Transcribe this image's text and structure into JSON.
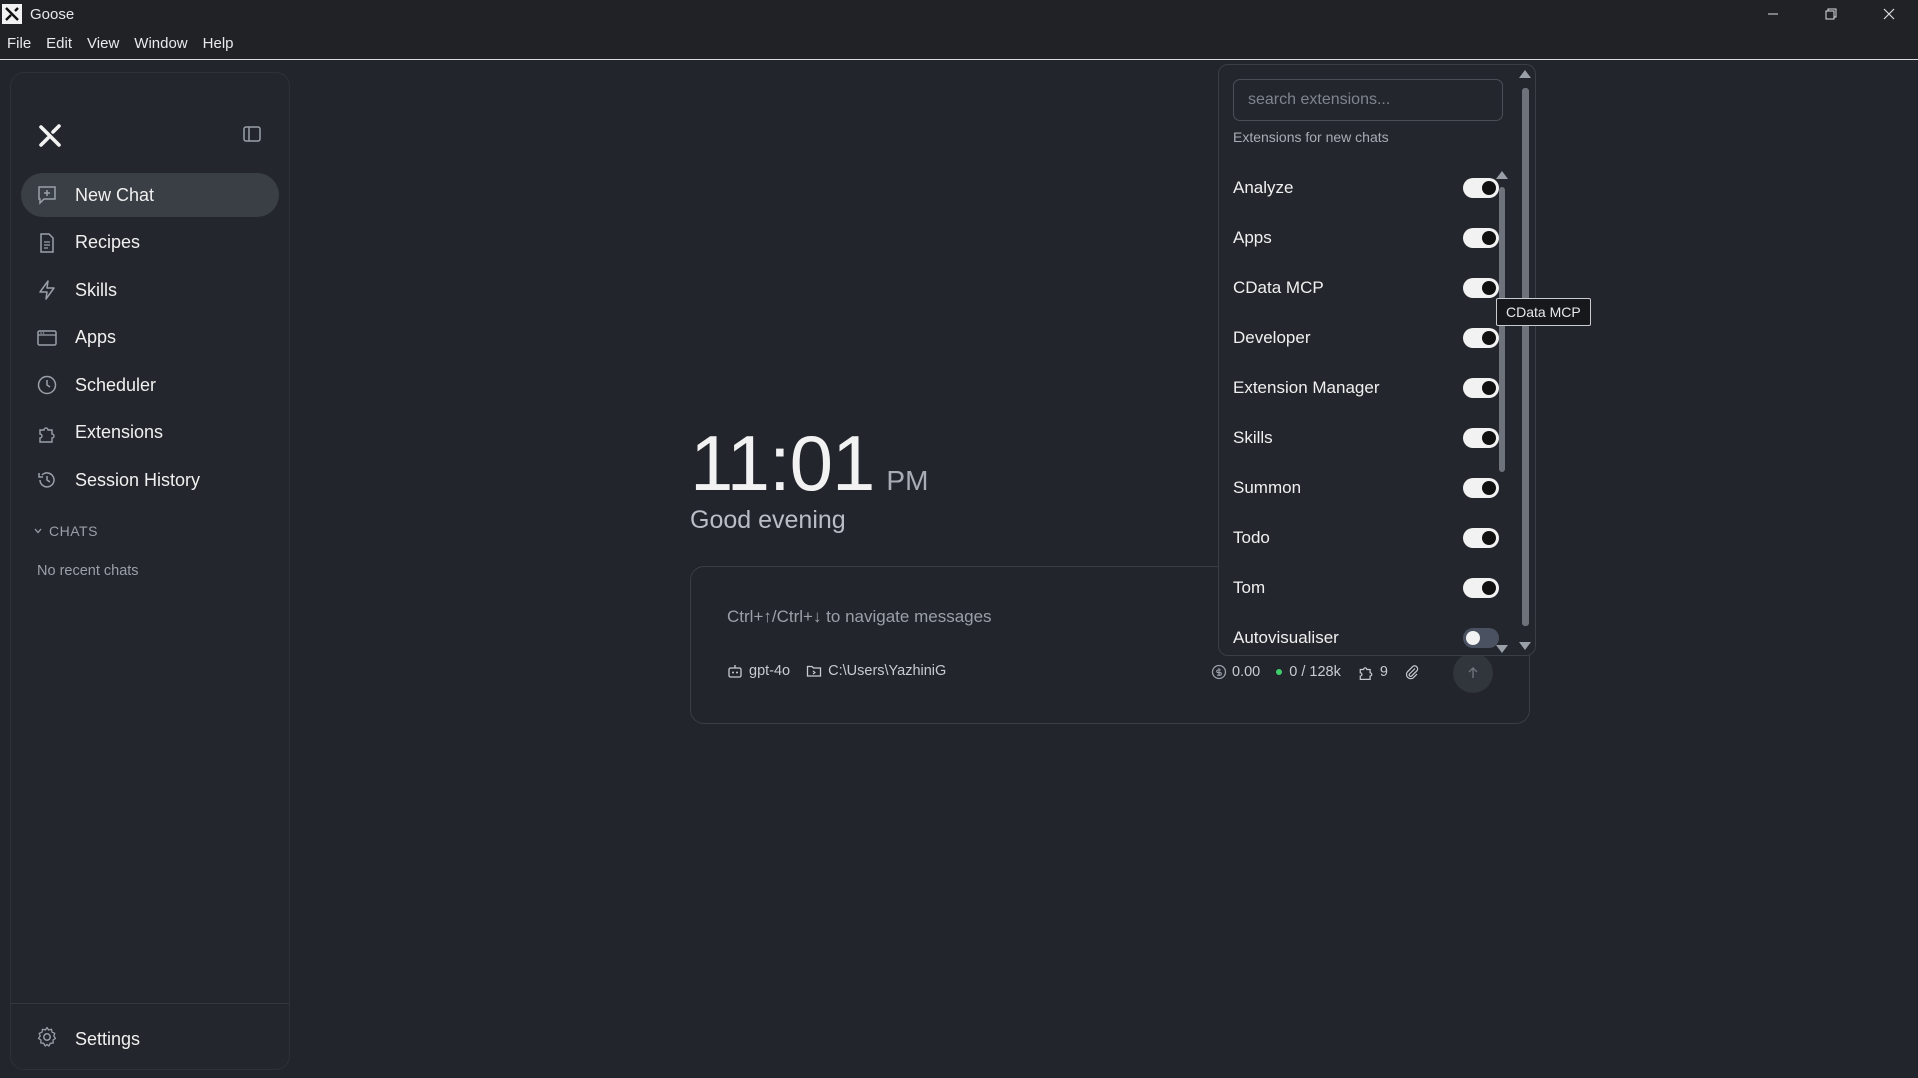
{
  "window": {
    "title": "Goose",
    "controls": [
      "minimize-icon",
      "restore-icon",
      "close-icon"
    ]
  },
  "menu": [
    "File",
    "Edit",
    "View",
    "Window",
    "Help"
  ],
  "sidebar": {
    "items": [
      {
        "label": "New Chat",
        "icon": "new-chat-icon"
      },
      {
        "label": "Recipes",
        "icon": "document-icon"
      },
      {
        "label": "Skills",
        "icon": "lightning-icon"
      },
      {
        "label": "Apps",
        "icon": "app-window-icon"
      },
      {
        "label": "Scheduler",
        "icon": "clock-icon"
      },
      {
        "label": "Extensions",
        "icon": "puzzle-icon"
      },
      {
        "label": "Session History",
        "icon": "history-icon"
      }
    ],
    "chats_header": "CHATS",
    "no_chats": "No recent chats",
    "settings_label": "Settings"
  },
  "main": {
    "time": "11:01",
    "ampm": "PM",
    "greeting": "Good evening"
  },
  "composer": {
    "placeholder": "Ctrl+↑/Ctrl+↓ to navigate messages",
    "model": "gpt-4o",
    "directory": "C:\\Users\\YazhiniG",
    "cost": "0.00",
    "context": "0 / 128k",
    "extensions_count": "9"
  },
  "extensions_panel": {
    "search_placeholder": "search extensions...",
    "subtitle": "Extensions for new chats",
    "items": [
      {
        "name": "Analyze",
        "enabled": true
      },
      {
        "name": "Apps",
        "enabled": true
      },
      {
        "name": "CData MCP",
        "enabled": true
      },
      {
        "name": "Developer",
        "enabled": true
      },
      {
        "name": "Extension Manager",
        "enabled": true
      },
      {
        "name": "Skills",
        "enabled": true
      },
      {
        "name": "Summon",
        "enabled": true
      },
      {
        "name": "Todo",
        "enabled": true
      },
      {
        "name": "Tom",
        "enabled": true
      },
      {
        "name": "Autovisualiser",
        "enabled": false
      }
    ],
    "tooltip": "CData MCP"
  },
  "colors": {
    "background": "#22252b",
    "active_nav": "#3a3e45",
    "toggle_on": "#f2f2f2",
    "toggle_off": "#4a5160",
    "status_green": "#3ecf6a"
  }
}
